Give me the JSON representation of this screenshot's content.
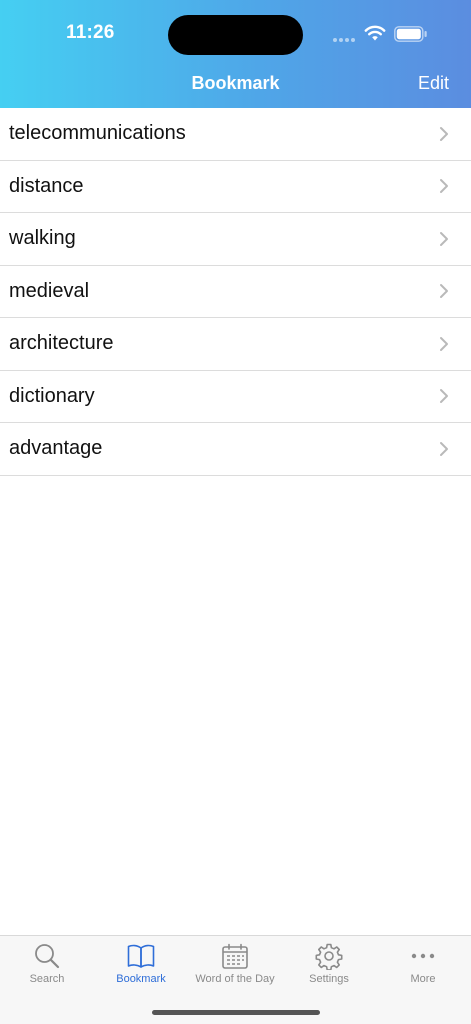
{
  "status_bar": {
    "time": "11:26"
  },
  "nav": {
    "title": "Bookmark",
    "edit_label": "Edit"
  },
  "bookmarks": [
    {
      "word": "telecommunications"
    },
    {
      "word": "distance"
    },
    {
      "word": "walking"
    },
    {
      "word": "medieval"
    },
    {
      "word": "architecture"
    },
    {
      "word": "dictionary"
    },
    {
      "word": "advantage"
    }
  ],
  "tabs": [
    {
      "label": "Search",
      "icon": "search-icon",
      "active": false
    },
    {
      "label": "Bookmark",
      "icon": "book-icon",
      "active": true
    },
    {
      "label": "Word of the Day",
      "icon": "calendar-icon",
      "active": false
    },
    {
      "label": "Settings",
      "icon": "gear-icon",
      "active": false
    },
    {
      "label": "More",
      "icon": "more-dots-icon",
      "active": false
    }
  ],
  "colors": {
    "header_gradient_start": "#45cff2",
    "header_gradient_end": "#5b8de0",
    "active_tab": "#2f6ed8",
    "inactive_tab": "#8a8a8a"
  }
}
